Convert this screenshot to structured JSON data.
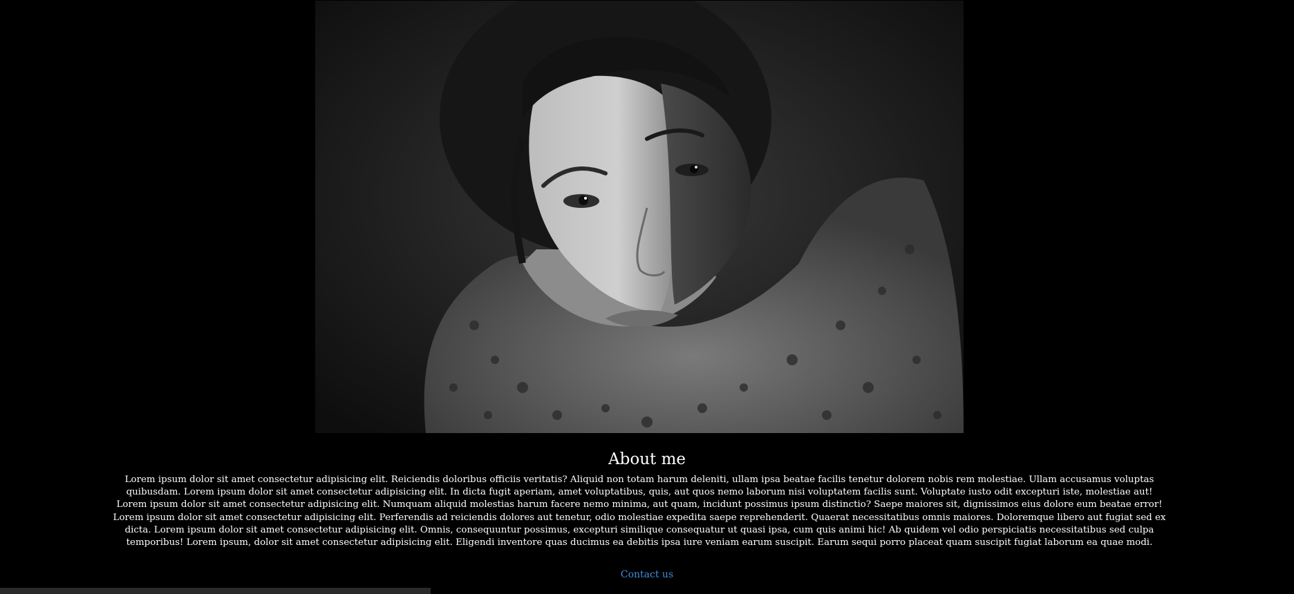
{
  "hero": {
    "image_alt": "Black and white portrait of a woman looking up",
    "image_icon": "portrait-photo"
  },
  "about": {
    "title": "About me",
    "body": "Lorem ipsum dolor sit amet consectetur adipisicing elit. Reiciendis doloribus officiis veritatis? Aliquid non totam harum deleniti, ullam ipsa beatae facilis tenetur dolorem nobis rem molestiae. Ullam accusamus voluptas quibusdam. Lorem ipsum dolor sit amet consectetur adipisicing elit. In dicta fugit aperiam, amet voluptatibus, quis, aut quos nemo laborum nisi voluptatem facilis sunt. Voluptate iusto odit excepturi iste, molestiae aut! Lorem ipsum dolor sit amet consectetur adipisicing elit. Numquam aliquid molestias harum facere nemo minima, aut quam, incidunt possimus ipsum distinctio? Saepe maiores sit, dignissimos eius dolore eum beatae error! Lorem ipsum dolor sit amet consectetur adipisicing elit. Perferendis ad reiciendis dolores aut tenetur, odio molestiae expedita saepe reprehenderit. Quaerat necessitatibus omnis maiores. Doloremque libero aut fugiat sed ex dicta. Lorem ipsum dolor sit amet consectetur adipisicing elit. Omnis, consequuntur possimus, excepturi similique consequatur ut quasi ipsa, cum quis animi hic! Ab quidem vel odio perspiciatis necessitatibus sed culpa temporibus! Lorem ipsum, dolor sit amet consectetur adipisicing elit. Eligendi inventore quas ducimus ea debitis ipsa iure veniam earum suscipit. Earum sequi porro placeat quam suscipit fugiat laborum ea quae modi."
  },
  "contact": {
    "label": "Contact us"
  },
  "colors": {
    "background": "#000000",
    "text": "#ffffff",
    "link": "#3f8fe0"
  }
}
